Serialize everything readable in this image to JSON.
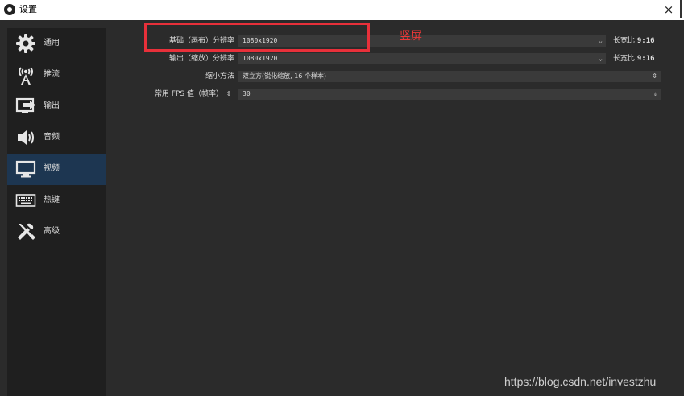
{
  "window": {
    "title": "设置",
    "close_symbol": "×"
  },
  "sidebar": {
    "items": [
      {
        "label": "通用",
        "icon": "gear-icon"
      },
      {
        "label": "推流",
        "icon": "antenna-icon"
      },
      {
        "label": "输出",
        "icon": "output-icon"
      },
      {
        "label": "音频",
        "icon": "speaker-icon"
      },
      {
        "label": "视频",
        "icon": "monitor-icon",
        "active": true
      },
      {
        "label": "热键",
        "icon": "keyboard-icon"
      },
      {
        "label": "高级",
        "icon": "tools-icon"
      }
    ]
  },
  "video": {
    "base_resolution": {
      "label": "基础（画布）分辨率",
      "value": "1080x1920",
      "aspect_prefix": "长宽比",
      "aspect_value": "9:16"
    },
    "output_resolution": {
      "label": "输出（缩放）分辨率",
      "value": "1080x1920",
      "aspect_prefix": "长宽比",
      "aspect_value": "9:16"
    },
    "downscale_filter": {
      "label": "缩小方法",
      "value": "双立方(锐化缩放, 16 个样本)"
    },
    "fps": {
      "label": "常用 FPS 值（帧率）",
      "value": "30"
    }
  },
  "annotation": {
    "note": "竖屏",
    "color": "#e8303a"
  },
  "watermark": "https://blog.csdn.net/investzhu",
  "colors": {
    "window_bg": "#2b2b2b",
    "sidebar_bg": "#1f1f1f",
    "sidebar_active": "#1d3651",
    "field_bg": "#3a3a3a"
  }
}
